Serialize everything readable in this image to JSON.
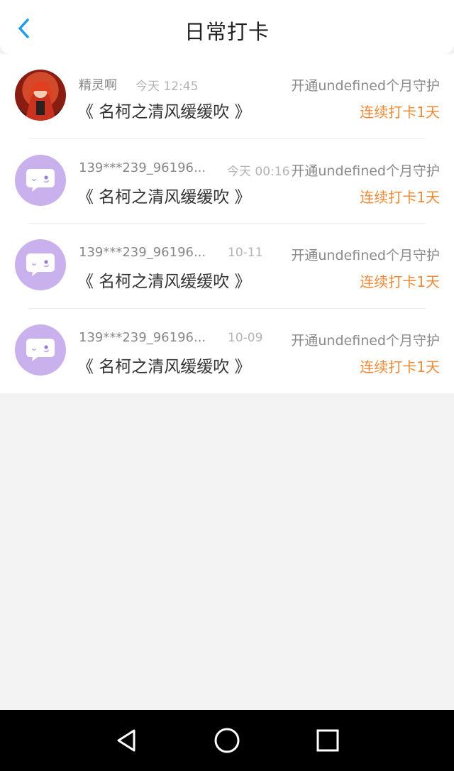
{
  "header": {
    "title": "日常打卡",
    "back_icon": "chevron-left-icon",
    "accent_color": "#1e9bf0"
  },
  "records": [
    {
      "avatar": "user-photo",
      "username": "精灵啊",
      "time": "今天 12:45",
      "guard_text": "开通undefined个月守护",
      "book": "《 名柯之清风缓缓吹 》",
      "streak": "连续打卡1天"
    },
    {
      "avatar": "chat-bubble-icon",
      "username": "139***239_96196...",
      "time": "今天 00:16",
      "guard_text": "开通undefined个月守护",
      "book": "《 名柯之清风缓缓吹 》",
      "streak": "连续打卡1天"
    },
    {
      "avatar": "chat-bubble-icon",
      "username": "139***239_96196...",
      "time": "10-11",
      "guard_text": "开通undefined个月守护",
      "book": "《 名柯之清风缓缓吹 》",
      "streak": "连续打卡1天"
    },
    {
      "avatar": "chat-bubble-icon",
      "username": "139***239_96196...",
      "time": "10-09",
      "guard_text": "开通undefined个月守护",
      "book": "《 名柯之清风缓缓吹 》",
      "streak": "连续打卡1天"
    }
  ],
  "colors": {
    "streak": "#f08a36",
    "avatar_bg": "#c9b1ee",
    "nav_bar": "#000000"
  },
  "nav": {
    "back": "triangle-back-icon",
    "home": "circle-home-icon",
    "recents": "square-recents-icon"
  }
}
